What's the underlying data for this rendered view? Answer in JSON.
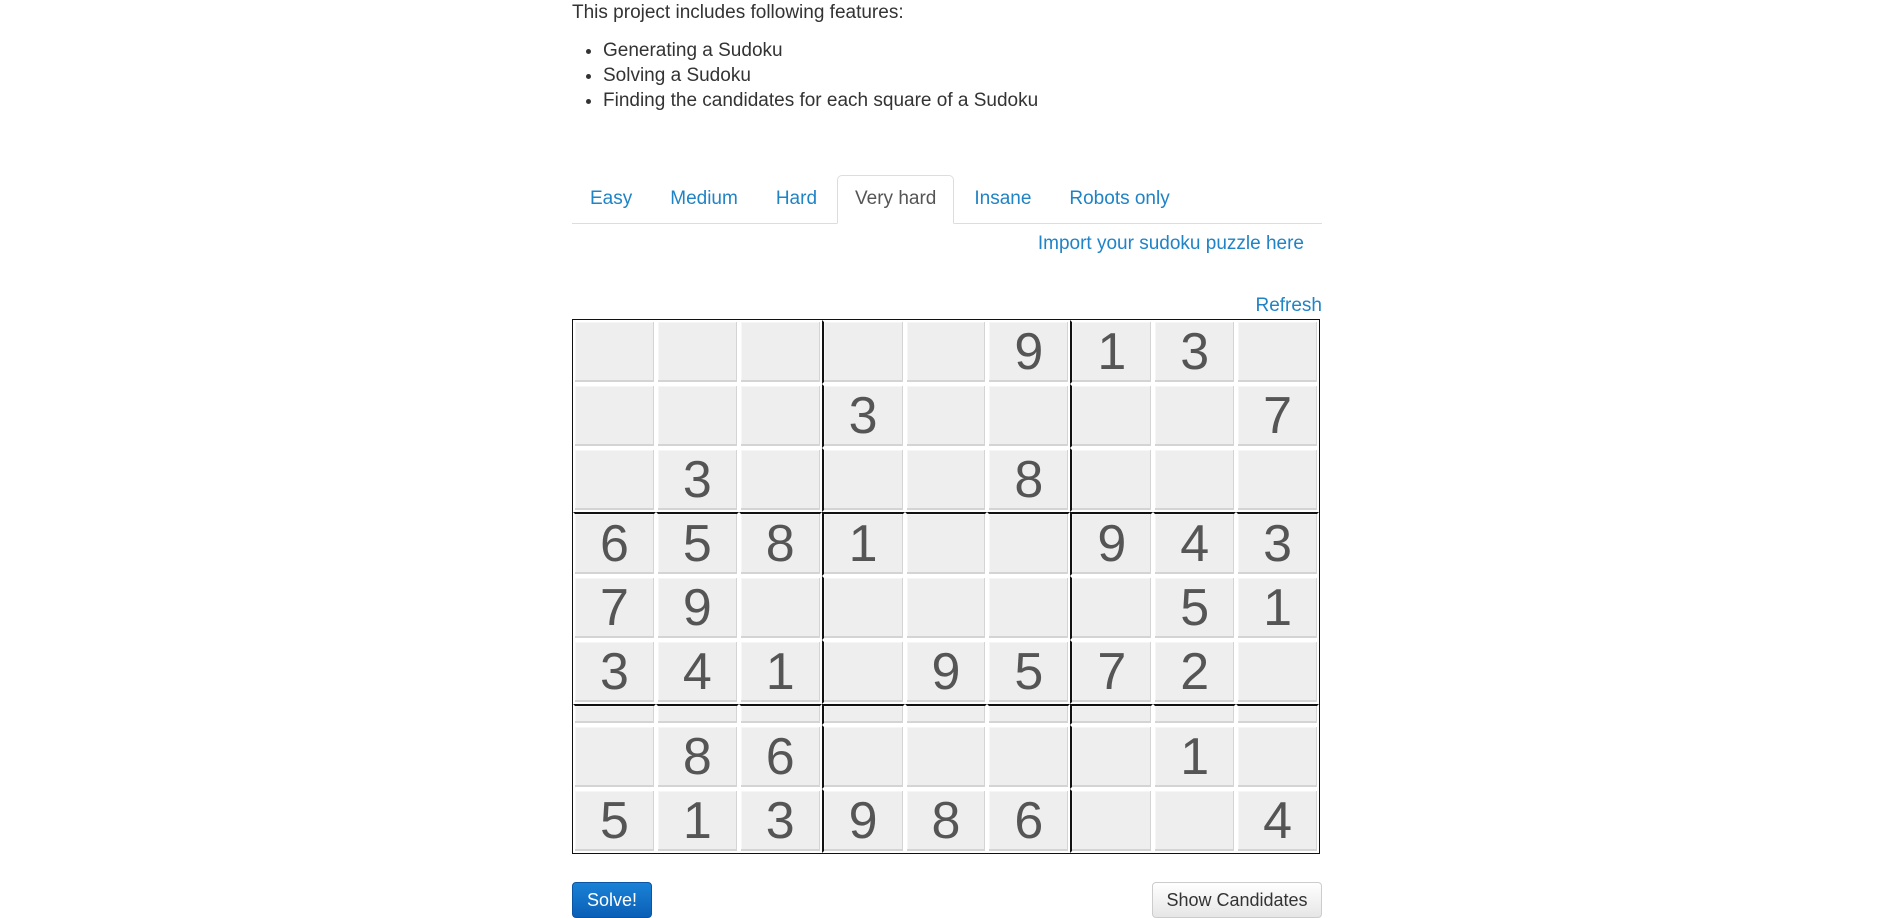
{
  "intro": "This project includes following features:",
  "features": [
    "Generating a Sudoku",
    "Solving a Sudoku",
    "Finding the candidates for each square of a Sudoku"
  ],
  "tabs": [
    {
      "label": "Easy",
      "active": false
    },
    {
      "label": "Medium",
      "active": false
    },
    {
      "label": "Hard",
      "active": false
    },
    {
      "label": "Very hard",
      "active": true
    },
    {
      "label": "Insane",
      "active": false
    },
    {
      "label": "Robots only",
      "active": false
    }
  ],
  "import_link": "Import your sudoku puzzle here",
  "refresh_link": "Refresh",
  "board": [
    [
      "",
      "",
      "",
      "",
      "",
      "9",
      "1",
      "3",
      ""
    ],
    [
      "",
      "",
      "",
      "3",
      "",
      "",
      "",
      "",
      "7"
    ],
    [
      "",
      "3",
      "",
      "",
      "",
      "8",
      "",
      "",
      ""
    ],
    [
      "6",
      "5",
      "8",
      "1",
      "",
      "",
      "9",
      "4",
      "3"
    ],
    [
      "7",
      "9",
      "",
      "",
      "",
      "",
      "",
      "5",
      "1"
    ],
    [
      "3",
      "4",
      "1",
      "",
      "9",
      "5",
      "7",
      "2",
      ""
    ],
    [
      "",
      "",
      "",
      "",
      "",
      "",
      "",
      "",
      ""
    ],
    [
      "",
      "8",
      "6",
      "",
      "",
      "",
      "",
      "1",
      ""
    ],
    [
      "5",
      "1",
      "3",
      "9",
      "8",
      "6",
      "",
      "",
      "4"
    ]
  ],
  "buttons": {
    "solve": "Solve!",
    "show_candidates": "Show Candidates"
  },
  "colors": {
    "link": "#1f83c6",
    "solve_button": "#0b5fb6",
    "cell_background": "#eeeeee"
  }
}
